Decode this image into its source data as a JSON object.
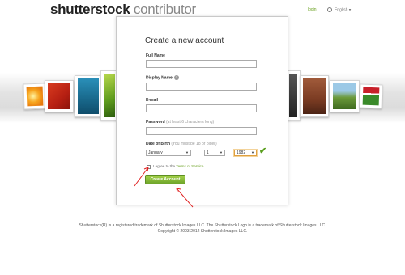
{
  "header": {
    "logo_bold": "shutterstock",
    "logo_light": "contributor",
    "login_link": "login",
    "language": "English",
    "language_arrow": "▾"
  },
  "form": {
    "title": "Create a new account",
    "full_name": {
      "label": "Full Name",
      "value": ""
    },
    "display_name": {
      "label": "Display Name",
      "help_icon": "?",
      "value": ""
    },
    "email": {
      "label": "E-mail",
      "value": ""
    },
    "password": {
      "label": "Password",
      "hint": "(at least 6 characters long)",
      "value": ""
    },
    "dob": {
      "label": "Date of Birth",
      "hint": "(You must be 18 or older)",
      "month": "January",
      "day": "1",
      "year": "1982",
      "valid_icon": "✔"
    },
    "terms": {
      "text": "I agree to the",
      "link": "Terms of Service",
      "checked": false
    },
    "submit_label": "Create Account"
  },
  "footer": {
    "line1": "Shutterstock(R) is a registered trademark of Shutterstock Images LLC. The Shutterstock Logo is a trademark of Shutterstock Images LLC.",
    "line2": "Copyright © 2003-2012 Shutterstock Images LLC."
  },
  "colors": {
    "accent_green": "#6aa121",
    "button_green": "#8cc63f",
    "annotation_red": "#e02020"
  },
  "icons": [
    "globe-icon",
    "help-icon",
    "checkmark-icon",
    "dropdown-arrow-icon"
  ]
}
